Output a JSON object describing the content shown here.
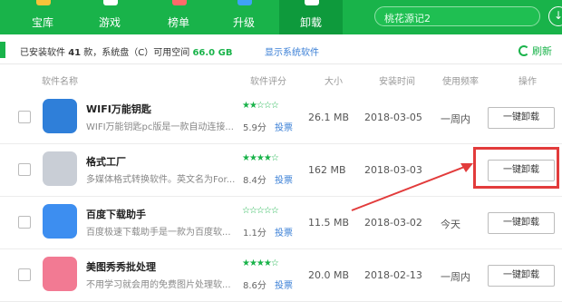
{
  "nav": [
    {
      "label": "宝库",
      "icon": "star-icon",
      "color": "#f6c33a"
    },
    {
      "label": "游戏",
      "icon": "gamepad-icon",
      "color": "#ffffff"
    },
    {
      "label": "榜单",
      "icon": "ranking-icon",
      "color": "#ff6a6a"
    },
    {
      "label": "升级",
      "icon": "upgrade-icon",
      "color": "#3fa2f7"
    },
    {
      "label": "卸载",
      "icon": "uninstall-icon",
      "color": "#ffffff"
    }
  ],
  "search": {
    "placeholder": "桃花源记2"
  },
  "info": {
    "prefix": "已安装软件",
    "count": "41",
    "mid": "款，系统盘（C）可用空间",
    "space": "66.0 GB",
    "show_system": "显示系统软件",
    "refresh": "刷新"
  },
  "columns": {
    "name": "软件名称",
    "rating": "软件评分",
    "size": "大小",
    "date": "安装时间",
    "freq": "使用频率",
    "action": "操作"
  },
  "rows": [
    {
      "name": "WIFI万能钥匙",
      "desc": "WIFI万能钥匙pc版是一款自动连接...",
      "stars": "★★☆☆☆",
      "score": "5.9分",
      "vote": "投票",
      "size": "26.1 MB",
      "date": "2018-03-05",
      "freq": "一周内",
      "btn": "一键卸载"
    },
    {
      "name": "格式工厂",
      "desc": "多媒体格式转换软件。英文名为For...",
      "stars": "★★★★☆",
      "score": "8.4分",
      "vote": "投票",
      "size": "162 MB",
      "date": "2018-03-03",
      "freq": "",
      "btn": "一键卸载"
    },
    {
      "name": "百度下载助手",
      "desc": "百度极速下载助手是一款为百度软...",
      "stars": "☆☆☆☆☆",
      "score": "1.1分",
      "vote": "投票",
      "size": "11.5 MB",
      "date": "2018-03-02",
      "freq": "今天",
      "btn": "一键卸载"
    },
    {
      "name": "美图秀秀批处理",
      "desc": "不用学习就会用的免费图片处理软...",
      "stars": "★★★★☆",
      "score": "8.6分",
      "vote": "投票",
      "size": "20.0 MB",
      "date": "2018-02-13",
      "freq": "一周内",
      "btn": "一键卸载"
    }
  ]
}
